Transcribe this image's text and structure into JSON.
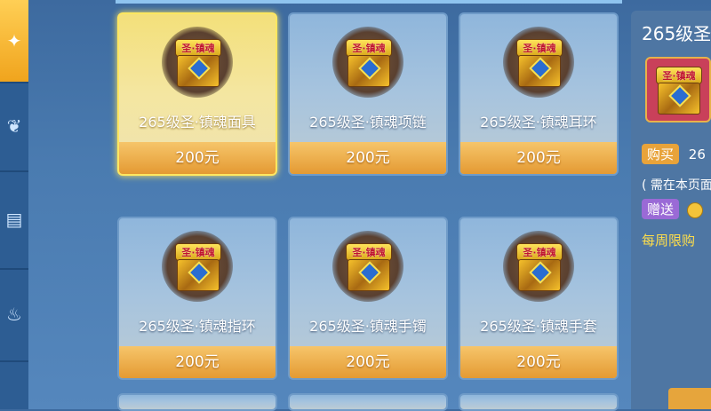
{
  "sidebar": {
    "tabs": [
      {
        "icon": "wing-icon",
        "active": true
      },
      {
        "icon": "feather-icon",
        "active": false
      },
      {
        "icon": "book-icon",
        "active": false
      },
      {
        "icon": "flame-icon",
        "active": false
      }
    ]
  },
  "items": [
    {
      "name": "265级圣·镇魂面具",
      "price": "200元",
      "chest_label": "圣·镇魂",
      "selected": true
    },
    {
      "name": "265级圣·镇魂项链",
      "price": "200元",
      "chest_label": "圣·镇魂",
      "selected": false
    },
    {
      "name": "265级圣·镇魂耳环",
      "price": "200元",
      "chest_label": "圣·镇魂",
      "selected": false
    },
    {
      "name": "265级圣·镇魂指环",
      "price": "200元",
      "chest_label": "圣·镇魂",
      "selected": false
    },
    {
      "name": "265级圣·镇魂手镯",
      "price": "200元",
      "chest_label": "圣·镇魂",
      "selected": false
    },
    {
      "name": "265级圣·镇魂手套",
      "price": "200元",
      "chest_label": "圣·镇魂",
      "selected": false
    }
  ],
  "detail": {
    "title": "265级圣",
    "chest_label": "圣·镇魂",
    "buy_label": "购买",
    "buy_value": "26",
    "note": "( 需在本页面",
    "gift_label": "赠送",
    "weekly_limit": "每周限购"
  },
  "colors": {
    "selected_border": "#ffe760",
    "price_bar": "#e49a33",
    "buy_badge": "#e8a33a",
    "gift_badge": "#9a6ad6",
    "limit_text": "#ffde4a"
  }
}
